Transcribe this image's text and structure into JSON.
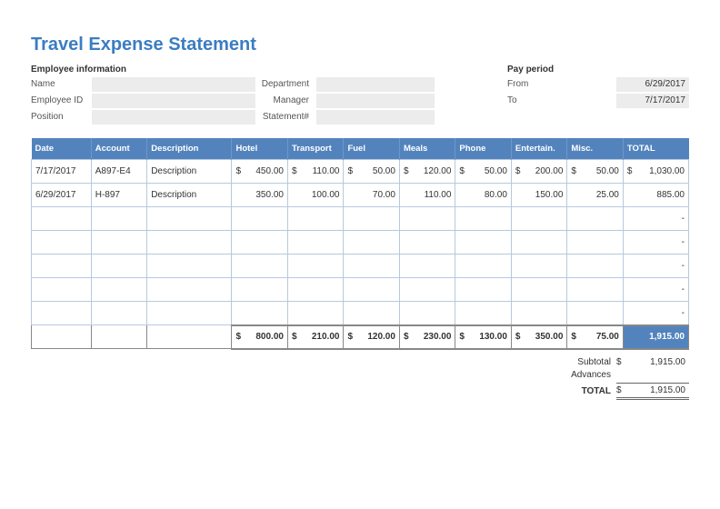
{
  "title": "Travel Expense Statement",
  "employee_info": {
    "heading": "Employee information",
    "name_label": "Name",
    "id_label": "Employee ID",
    "position_label": "Position",
    "department_label": "Department",
    "manager_label": "Manager",
    "statement_label": "Statement#"
  },
  "pay_period": {
    "heading": "Pay period",
    "from_label": "From",
    "to_label": "To",
    "from": "6/29/2017",
    "to": "7/17/2017"
  },
  "columns": {
    "date": "Date",
    "account": "Account",
    "description": "Description",
    "hotel": "Hotel",
    "transport": "Transport",
    "fuel": "Fuel",
    "meals": "Meals",
    "phone": "Phone",
    "entertain": "Entertain.",
    "misc": "Misc.",
    "total": "TOTAL"
  },
  "rows": [
    {
      "date": "7/17/2017",
      "account": "A897-E4",
      "description": "Description",
      "hotel": "450.00",
      "transport": "110.00",
      "fuel": "50.00",
      "meals": "120.00",
      "phone": "50.00",
      "entertain": "200.00",
      "misc": "50.00",
      "total": "1,030.00",
      "show_dollar": true
    },
    {
      "date": "6/29/2017",
      "account": "H-897",
      "description": "Description",
      "hotel": "350.00",
      "transport": "100.00",
      "fuel": "70.00",
      "meals": "110.00",
      "phone": "80.00",
      "entertain": "150.00",
      "misc": "25.00",
      "total": "885.00",
      "show_dollar": false
    }
  ],
  "empty_rows": 5,
  "dash": "-",
  "column_totals": {
    "hotel": "800.00",
    "transport": "210.00",
    "fuel": "120.00",
    "meals": "230.00",
    "phone": "130.00",
    "entertain": "350.00",
    "misc": "75.00",
    "total": "1,915.00"
  },
  "summary": {
    "subtotal_label": "Subtotal",
    "subtotal": "1,915.00",
    "advances_label": "Advances",
    "total_label": "TOTAL",
    "total": "1,915.00"
  },
  "currency": "$",
  "chart_data": {
    "type": "table",
    "title": "Travel Expense Statement",
    "columns": [
      "Date",
      "Account",
      "Description",
      "Hotel",
      "Transport",
      "Fuel",
      "Meals",
      "Phone",
      "Entertain.",
      "Misc.",
      "TOTAL"
    ],
    "rows": [
      [
        "7/17/2017",
        "A897-E4",
        "Description",
        450.0,
        110.0,
        50.0,
        120.0,
        50.0,
        200.0,
        50.0,
        1030.0
      ],
      [
        "6/29/2017",
        "H-897",
        "Description",
        350.0,
        100.0,
        70.0,
        110.0,
        80.0,
        150.0,
        25.0,
        885.0
      ]
    ],
    "column_totals": {
      "Hotel": 800.0,
      "Transport": 210.0,
      "Fuel": 120.0,
      "Meals": 230.0,
      "Phone": 130.0,
      "Entertain.": 350.0,
      "Misc.": 75.0,
      "TOTAL": 1915.0
    },
    "subtotal": 1915.0,
    "advances": null,
    "grand_total": 1915.0,
    "pay_period": {
      "from": "6/29/2017",
      "to": "7/17/2017"
    }
  }
}
